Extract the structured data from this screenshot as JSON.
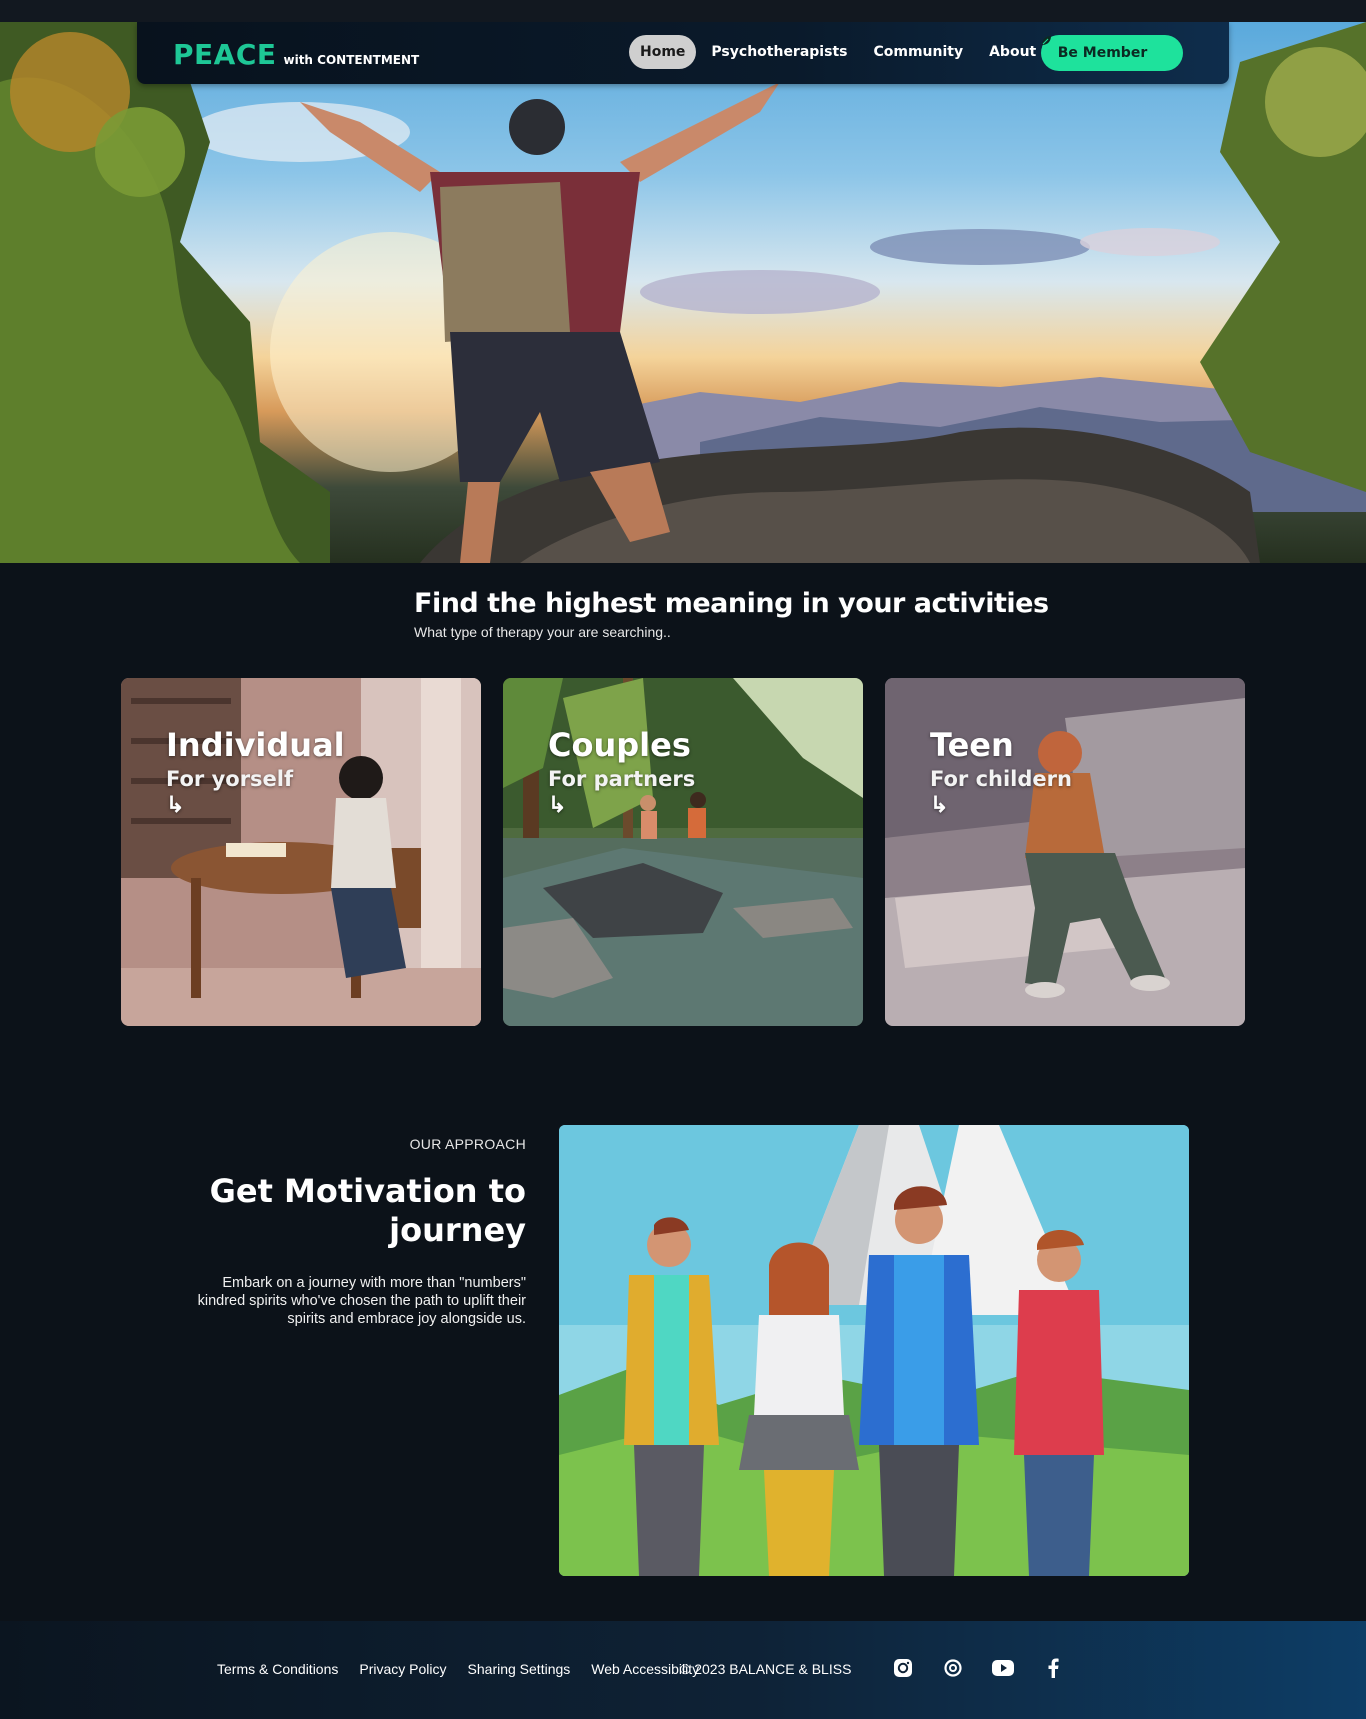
{
  "brand": {
    "name": "PEACE",
    "tagline": "with CONTENTMENT",
    "accent": "#1ec796"
  },
  "nav": {
    "items": [
      {
        "label": "Home",
        "active": true
      },
      {
        "label": "Psychotherapists",
        "active": false
      },
      {
        "label": "Community",
        "active": false
      },
      {
        "label": "About Us",
        "active": false
      }
    ],
    "cta_label": "Be Member",
    "cta_icon": "leaf-icon",
    "cta_color": "#1ee29c"
  },
  "intro": {
    "title": "Find the highest meaning in your activities",
    "subtitle": "What type of therapy your are searching.."
  },
  "cards": [
    {
      "title": "Individual",
      "subtitle": "For yorself",
      "arrow": "↳"
    },
    {
      "title": "Couples",
      "subtitle": "For partners",
      "arrow": "↳"
    },
    {
      "title": "Teen",
      "subtitle": "For childern",
      "arrow": "↳"
    }
  ],
  "approach": {
    "eyebrow": "OUR APPROACH",
    "title": "Get Motivation to journey",
    "text": "Embark on a journey with more than \"numbers\" kindred spirits who've chosen the path to uplift their spirits and embrace joy alongside us."
  },
  "footer": {
    "links": [
      "Terms & Conditions",
      "Privacy Policy",
      "Sharing Settings",
      "Web Accessibility"
    ],
    "copyright": "© 2023 BALANCE & BLISS",
    "social_icons": [
      "instagram-icon",
      "threads-icon",
      "youtube-icon",
      "facebook-icon"
    ]
  }
}
